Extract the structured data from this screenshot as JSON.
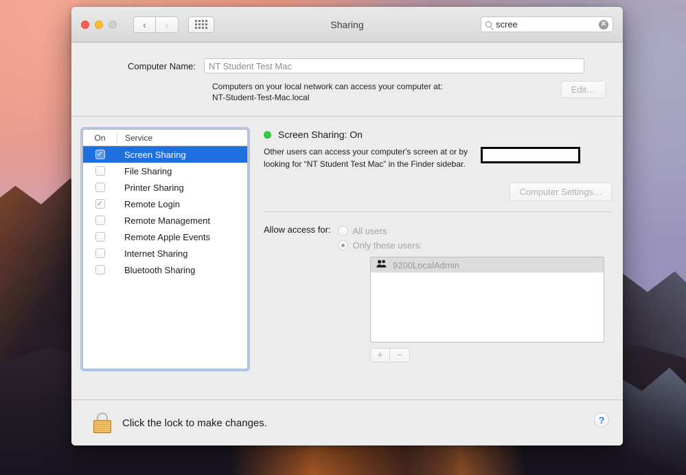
{
  "window": {
    "title": "Sharing",
    "traffic_lights": [
      "close",
      "minimize",
      "zoom"
    ],
    "nav": {
      "back": "‹",
      "forward": "›"
    },
    "show_all_label": "show-all"
  },
  "search": {
    "value": "scree",
    "placeholder": "Search",
    "clear_glyph": "✕"
  },
  "computer_name": {
    "label": "Computer Name:",
    "value": "NT Student Test Mac",
    "description_line1": "Computers on your local network can access your computer at:",
    "description_line2": "NT-Student-Test-Mac.local",
    "edit_button": "Edit…"
  },
  "services": {
    "header_on": "On",
    "header_service": "Service",
    "items": [
      {
        "name": "Screen Sharing",
        "checked": true,
        "selected": true
      },
      {
        "name": "File Sharing",
        "checked": false,
        "selected": false
      },
      {
        "name": "Printer Sharing",
        "checked": false,
        "selected": false
      },
      {
        "name": "Remote Login",
        "checked": true,
        "selected": false
      },
      {
        "name": "Remote Management",
        "checked": false,
        "selected": false
      },
      {
        "name": "Remote Apple Events",
        "checked": false,
        "selected": false
      },
      {
        "name": "Internet Sharing",
        "checked": false,
        "selected": false
      },
      {
        "name": "Bluetooth Sharing",
        "checked": false,
        "selected": false
      }
    ],
    "check_glyph": "✓"
  },
  "detail": {
    "status_text": "Screen Sharing: On",
    "status_color": "#35c945",
    "description_part1": "Other users can access your computer's screen at",
    "description_part2": "or by",
    "description_line2": "looking for “NT Student Test Mac” in the Finder sidebar.",
    "redacted": true,
    "computer_settings_button": "Computer Settings…",
    "access_label": "Allow access for:",
    "radio_all_users": "All users",
    "radio_only_these": "Only these users:",
    "selected_radio": "only_these",
    "users": [
      {
        "name": "9200LocalAdmin",
        "icon": "group-icon",
        "selected": true
      }
    ],
    "add_button": "+",
    "remove_button": "−"
  },
  "footer": {
    "lock_state": "locked",
    "lock_text": "Click the lock to make changes.",
    "help_glyph": "?"
  }
}
